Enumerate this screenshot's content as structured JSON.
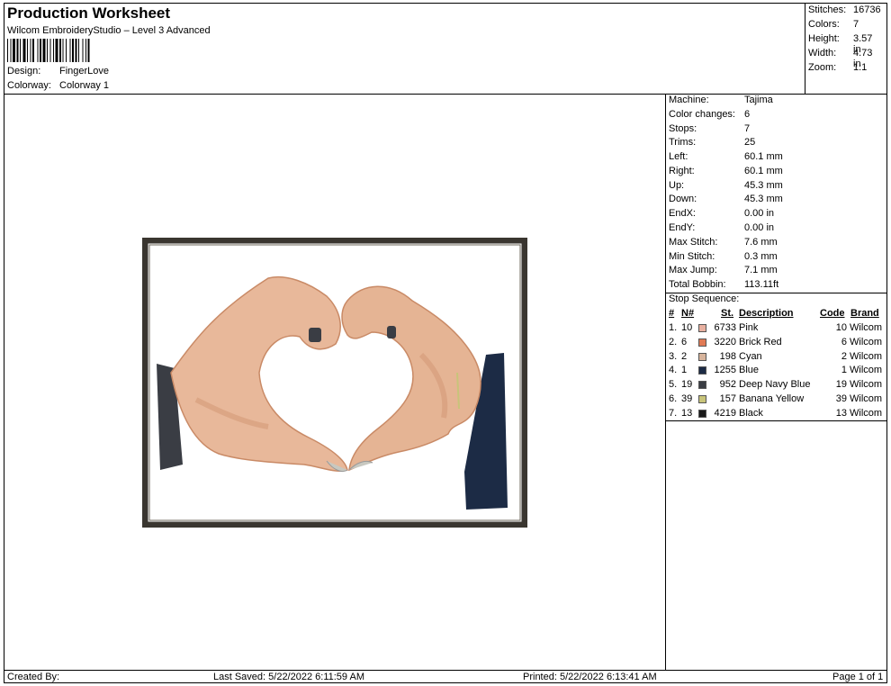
{
  "header": {
    "title": "Production Worksheet",
    "subtitle": "Wilcom EmbroideryStudio – Level 3 Advanced",
    "design_label": "Design:",
    "design_value": "FingerLove",
    "colorway_label": "Colorway:",
    "colorway_value": "Colorway 1"
  },
  "summary": [
    {
      "label": "Stitches:",
      "value": "16736"
    },
    {
      "label": "Colors:",
      "value": "7"
    },
    {
      "label": "Height:",
      "value": "3.57 in"
    },
    {
      "label": "Width:",
      "value": "4.73 in"
    },
    {
      "label": "Zoom:",
      "value": "1:1"
    }
  ],
  "machine_info": [
    {
      "label": "Machine:",
      "value": "Tajima"
    },
    {
      "label": "Color changes:",
      "value": "6"
    },
    {
      "label": "Stops:",
      "value": "7"
    },
    {
      "label": "Trims:",
      "value": "25"
    },
    {
      "label": "Left:",
      "value": "60.1 mm"
    },
    {
      "label": "Right:",
      "value": "60.1 mm"
    },
    {
      "label": "Up:",
      "value": "45.3 mm"
    },
    {
      "label": "Down:",
      "value": "45.3 mm"
    },
    {
      "label": "EndX:",
      "value": "0.00 in"
    },
    {
      "label": "EndY:",
      "value": "0.00 in"
    },
    {
      "label": "Max Stitch:",
      "value": "7.6 mm"
    },
    {
      "label": "Min Stitch:",
      "value": "0.3 mm"
    },
    {
      "label": "Max Jump:",
      "value": "7.1 mm"
    },
    {
      "label": "Total Bobbin:",
      "value": "113.11ft"
    }
  ],
  "stop_sequence": {
    "title": "Stop Sequence:",
    "columns": {
      "num": "#",
      "n": "N#",
      "st": "St.",
      "description": "Description",
      "code": "Code",
      "brand": "Brand"
    },
    "rows": [
      {
        "num": "1.",
        "n": "10",
        "color": "#e8b0a0",
        "st": "6733",
        "description": "Pink",
        "code": "10",
        "brand": "Wilcom"
      },
      {
        "num": "2.",
        "n": "6",
        "color": "#e07a55",
        "st": "3220",
        "description": "Brick Red",
        "code": "6",
        "brand": "Wilcom"
      },
      {
        "num": "3.",
        "n": "2",
        "color": "#d7b49c",
        "st": "198",
        "description": "Cyan",
        "code": "2",
        "brand": "Wilcom"
      },
      {
        "num": "4.",
        "n": "1",
        "color": "#1c2b45",
        "st": "1255",
        "description": "Blue",
        "code": "1",
        "brand": "Wilcom"
      },
      {
        "num": "5.",
        "n": "19",
        "color": "#3a3d44",
        "st": "952",
        "description": "Deep Navy Blue",
        "code": "19",
        "brand": "Wilcom"
      },
      {
        "num": "6.",
        "n": "39",
        "color": "#c8c47a",
        "st": "157",
        "description": "Banana Yellow",
        "code": "39",
        "brand": "Wilcom"
      },
      {
        "num": "7.",
        "n": "13",
        "color": "#1a1a1a",
        "st": "4219",
        "description": "Black",
        "code": "13",
        "brand": "Wilcom"
      }
    ]
  },
  "footer": {
    "created_by": "Created By:",
    "last_saved": "Last Saved: 5/22/2022 6:11:59 AM",
    "printed": "Printed: 5/22/2022 6:13:41 AM",
    "page": "Page 1 of 1"
  }
}
